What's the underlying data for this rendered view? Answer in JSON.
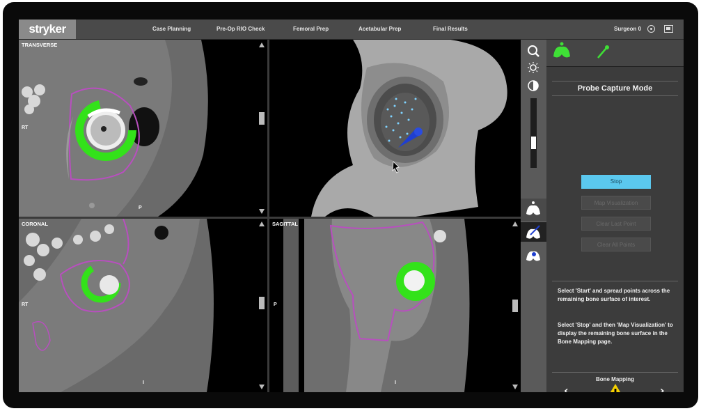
{
  "app": {
    "brand": "stryker",
    "user": "Surgeon 0"
  },
  "nav": {
    "items": [
      "Case Planning",
      "Pre-Op RIO Check",
      "Femoral Prep",
      "Acetabular Prep",
      "Final Results"
    ]
  },
  "views": {
    "transverse": {
      "label": "TRANSVERSE",
      "left_marker": "RT",
      "bottom_marker": "P"
    },
    "coronal": {
      "label": "CORONAL",
      "left_marker": "RT",
      "bottom_marker": "I"
    },
    "sagittal": {
      "label": "SAGITTAL",
      "left_marker": "P",
      "bottom_marker": "I"
    }
  },
  "icons": {
    "zoom": "magnifier-icon",
    "brightness": "sun-icon",
    "contrast": "contrast-icon",
    "pelvis": "pelvis-icon",
    "probe": "probe-icon",
    "warning": "warning-icon",
    "user_settings": "gear-icon",
    "display": "monitor-icon"
  },
  "colors": {
    "accent": "#5bc8ee",
    "implant": "#33e21a",
    "bone_outline": "#b84fbf",
    "warning": "#f5d000",
    "probe": "#1f3fd0",
    "pelvis_icon": "#3fe036"
  },
  "panel": {
    "title": "Probe Capture Mode",
    "buttons": {
      "stop": "Stop",
      "map": "Map Visualization",
      "clear_last": "Clear Last Point",
      "clear_all": "Clear All Points"
    },
    "instructions": [
      "Select 'Start' and spread points across the remaining bone surface of interest.",
      "Select 'Stop' and then 'Map Visualization' to display the remaining bone surface in the Bone Mapping page."
    ],
    "footer": {
      "label": "Bone Mapping",
      "prev": "‹",
      "next": "›"
    }
  }
}
